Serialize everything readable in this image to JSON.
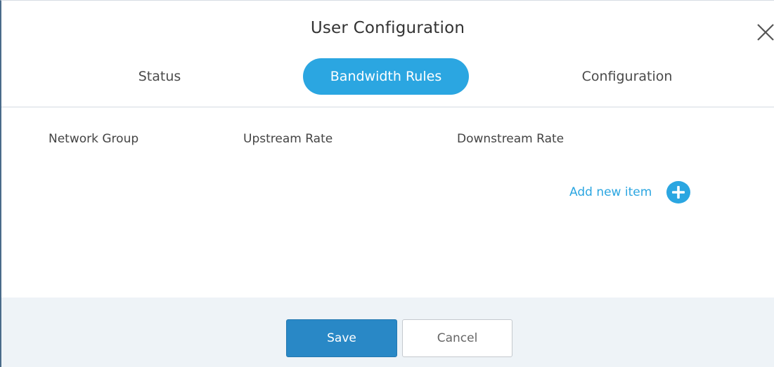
{
  "dialog": {
    "title": "User Configuration"
  },
  "tabs": [
    {
      "label": "Status",
      "active": false
    },
    {
      "label": "Bandwidth Rules",
      "active": true
    },
    {
      "label": "Configuration",
      "active": false
    }
  ],
  "table": {
    "columns": [
      "Network Group",
      "Upstream Rate",
      "Downstream Rate"
    ],
    "rows": []
  },
  "actions": {
    "add_item_label": "Add new item",
    "add_icon": "plus-circle-icon",
    "close_icon": "close-icon"
  },
  "footer": {
    "save_label": "Save",
    "cancel_label": "Cancel"
  },
  "colors": {
    "accent": "#2ba6e1",
    "save_button": "#2988c6",
    "footer_background": "#eef3f7"
  }
}
